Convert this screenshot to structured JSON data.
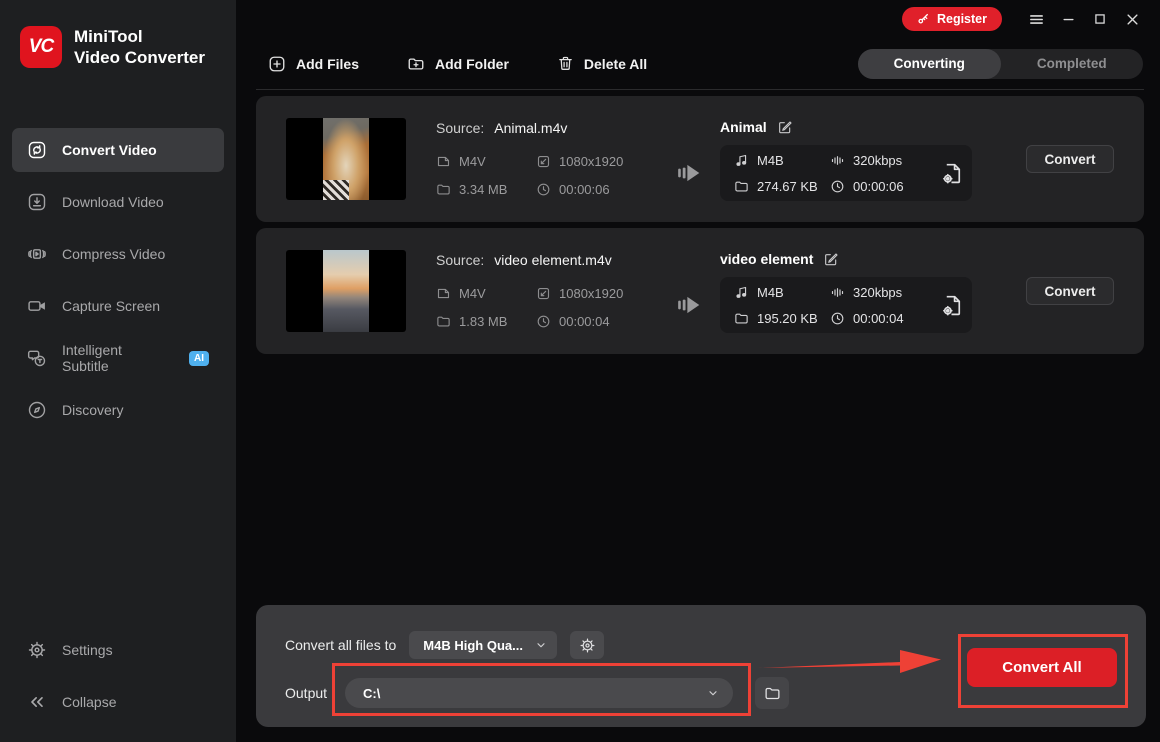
{
  "app": {
    "logo_text": "VC",
    "title_line1": "MiniTool",
    "title_line2": "Video Converter"
  },
  "titlebar": {
    "register_label": "Register"
  },
  "sidebar": {
    "items": [
      {
        "label": "Convert Video",
        "active": true
      },
      {
        "label": "Download Video",
        "active": false
      },
      {
        "label": "Compress Video",
        "active": false
      },
      {
        "label": "Capture Screen",
        "active": false
      },
      {
        "label": "Intelligent Subtitle",
        "active": false,
        "badge": "AI"
      },
      {
        "label": "Discovery",
        "active": false
      }
    ],
    "settings_label": "Settings",
    "collapse_label": "Collapse"
  },
  "toolbar": {
    "add_files_label": "Add Files",
    "add_folder_label": "Add Folder",
    "delete_all_label": "Delete All",
    "tabs": [
      {
        "label": "Converting",
        "active": true
      },
      {
        "label": "Completed",
        "active": false
      }
    ]
  },
  "files": [
    {
      "source_label": "Source:",
      "source_name": "Animal.m4v",
      "format": "M4V",
      "resolution": "1080x1920",
      "size": "3.34 MB",
      "duration": "00:00:06",
      "target_name": "Animal",
      "target_format": "M4B",
      "target_bitrate": "320kbps",
      "target_size": "274.67 KB",
      "target_duration": "00:00:06",
      "convert_label": "Convert"
    },
    {
      "source_label": "Source:",
      "source_name": "video element.m4v",
      "format": "M4V",
      "resolution": "1080x1920",
      "size": "1.83 MB",
      "duration": "00:00:04",
      "target_name": "video element",
      "target_format": "M4B",
      "target_bitrate": "320kbps",
      "target_size": "195.20 KB",
      "target_duration": "00:00:04",
      "convert_label": "Convert"
    }
  ],
  "bottom_bar": {
    "convert_all_files_to_label": "Convert all files to",
    "format_value": "M4B High Qua...",
    "output_label": "Output",
    "output_path": "C:\\",
    "convert_all_label": "Convert All"
  },
  "colors": {
    "brand_red": "#e0141e",
    "convert_all_red": "#dc1f26",
    "annotation_red": "#ee4136",
    "ai_badge_blue": "#4fb0ee",
    "sidebar_bg": "#1e1f21",
    "main_bg": "#0a0a0c",
    "card_bg": "#232325",
    "bottom_bar_bg": "#3a3a3d"
  },
  "icons": {
    "logo": "VC monogram",
    "key-icon": "key",
    "menu-icon": "hamburger",
    "minimize-icon": "–",
    "maximize-icon": "□",
    "close-icon": "✕",
    "convert-video-icon": "sync arrows ⟳",
    "download-video-icon": "download ↓",
    "compress-video-icon": "compress frame",
    "capture-screen-icon": "video camera",
    "intelligent-subtitle-icon": "speech bubbles",
    "discovery-icon": "compass",
    "gear-icon": "⚙",
    "collapse-icon": "«",
    "add-files-icon": "plus square ⊞",
    "add-folder-icon": "folder plus",
    "delete-all-icon": "trash",
    "format-file-icon": "media file",
    "resolution-icon": "screen frame",
    "folder-icon": "folder",
    "clock-icon": "clock",
    "transfer-arrow-icon": "fast-forward arrow",
    "audio-file-icon": "music note ♫",
    "bitrate-icon": "waveform bars",
    "output-settings-icon": "document with gear",
    "edit-icon": "pencil in square",
    "chevron-down-icon": "⌄"
  }
}
